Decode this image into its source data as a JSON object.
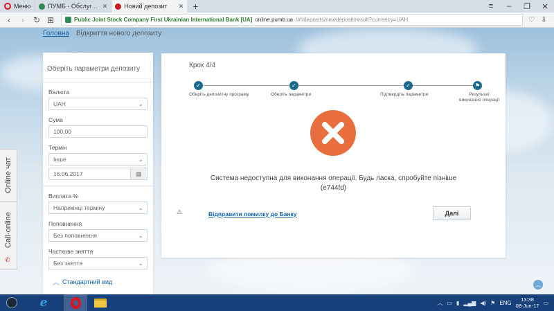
{
  "browser": {
    "menu_label": "Меню",
    "tabs": [
      {
        "title": "ПУМБ - Обслуговування",
        "favicon": "green",
        "active": false
      },
      {
        "title": "Новий депозит",
        "favicon": "red",
        "active": true
      }
    ],
    "new_tab": "+",
    "address": {
      "certificate": "Public Joint Stock Company First Ukrainian International Bank [UA]",
      "domain": "online.pumb.ua",
      "path": "/#!/deposits/newdeposit/result?currency=UAH"
    }
  },
  "breadcrumb": {
    "home": "Головна",
    "current": "Відкриття нового депозиту"
  },
  "params": {
    "title": "Оберіть параметри депозиту",
    "currency_label": "Валюта",
    "currency_value": "UAH",
    "amount_label": "Сума",
    "amount_value": "100,00",
    "term_label": "Термін",
    "term_value": "Інше",
    "date_value": "16.06.2017",
    "payout_label": "Виплата %",
    "payout_value": "Наприкінці терміну",
    "topup_label": "Поповнення",
    "topup_value": "Без поповнення",
    "withdraw_label": "Часткове зняття",
    "withdraw_value": "Без зняття",
    "standard_view": "Стандартний вид"
  },
  "side_tabs": {
    "chat": "Online чат",
    "call": "Call-online"
  },
  "wizard": {
    "step_label": "Крок 4/4",
    "steps": [
      "Оберіть депозитну програму",
      "Оберіть параметри",
      "Підтвердіть параметри",
      "Результат\nвиконання операції"
    ],
    "error_message": "Система недоступна для виконання операції. Будь ласка, спробуйте пізніше",
    "error_code": "(e744fd)",
    "report_link": "Відправити помилку до Банку",
    "next_button": "Далі"
  },
  "taskbar": {
    "language": "ENG",
    "time": "13:38",
    "date": "08-Jun-17"
  },
  "colors": {
    "accent": "#1b6a8d",
    "error": "#e86d3f",
    "link": "#1565a8"
  }
}
